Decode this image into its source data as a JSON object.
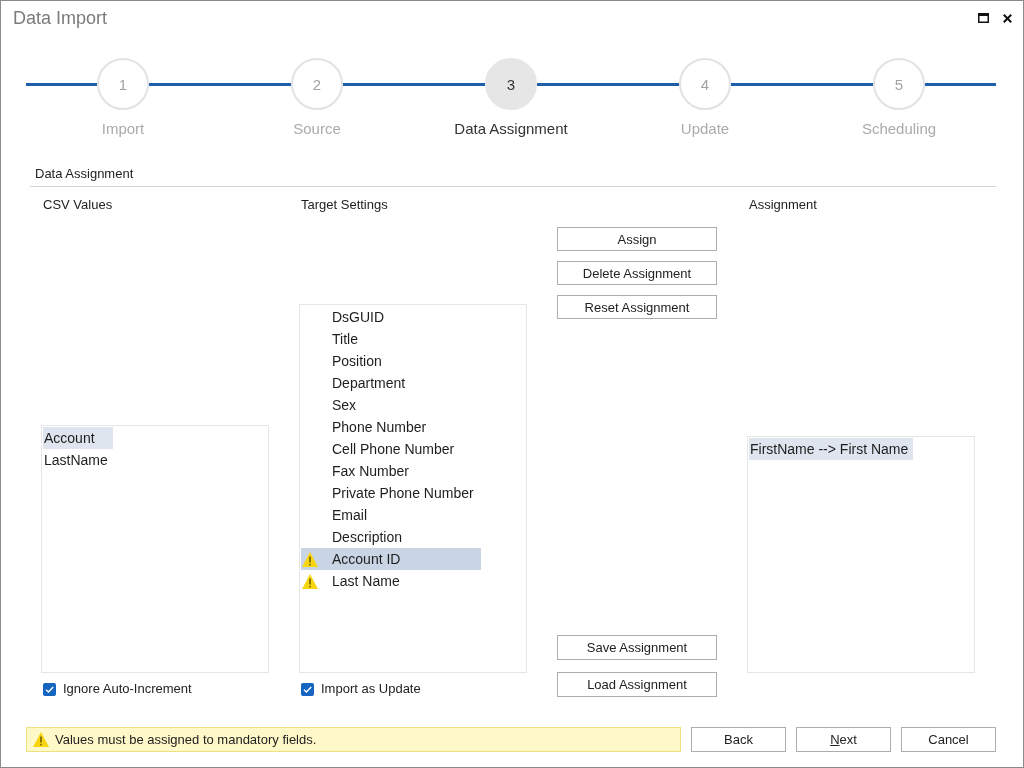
{
  "window": {
    "title": "Data Import"
  },
  "steps": [
    {
      "number": "1",
      "label": "Import",
      "selected": false
    },
    {
      "number": "2",
      "label": "Source",
      "selected": false
    },
    {
      "number": "3",
      "label": "Data Assignment",
      "selected": true
    },
    {
      "number": "4",
      "label": "Update",
      "selected": false
    },
    {
      "number": "5",
      "label": "Scheduling",
      "selected": false
    }
  ],
  "section": {
    "title": "Data Assignment"
  },
  "csv_values": {
    "heading": "CSV Values",
    "focused": false,
    "items": [
      {
        "label": "Account",
        "selected": true
      },
      {
        "label": "LastName",
        "selected": false
      }
    ]
  },
  "target_settings": {
    "heading": "Target Settings",
    "focused": true,
    "items": [
      {
        "label": "DsGUID",
        "warning": false,
        "selected": false
      },
      {
        "label": "Title",
        "warning": false,
        "selected": false
      },
      {
        "label": "Position",
        "warning": false,
        "selected": false
      },
      {
        "label": "Department",
        "warning": false,
        "selected": false
      },
      {
        "label": "Sex",
        "warning": false,
        "selected": false
      },
      {
        "label": "Phone Number",
        "warning": false,
        "selected": false
      },
      {
        "label": "Cell Phone Number",
        "warning": false,
        "selected": false
      },
      {
        "label": "Fax Number",
        "warning": false,
        "selected": false
      },
      {
        "label": "Private Phone Number",
        "warning": false,
        "selected": false
      },
      {
        "label": "Email",
        "warning": false,
        "selected": false
      },
      {
        "label": "Description",
        "warning": false,
        "selected": false
      },
      {
        "label": "Account ID",
        "warning": true,
        "selected": true
      },
      {
        "label": "Last Name",
        "warning": true,
        "selected": false
      }
    ]
  },
  "action_buttons": [
    "Assign",
    "Delete Assignment",
    "Reset Assignment"
  ],
  "file_buttons": [
    "Save Assignment",
    "Load Assignment"
  ],
  "assignment": {
    "heading": "Assignment",
    "focused": false,
    "items": [
      {
        "label": "FirstName --> First Name",
        "selected": true
      }
    ]
  },
  "options": [
    {
      "label": "Ignore Auto-Increment",
      "checked": true
    },
    {
      "label": "Import as Update",
      "checked": true
    }
  ],
  "status": {
    "kind": "warning",
    "message": "Values must be assigned to mandatory fields."
  },
  "nav_buttons": [
    {
      "label": "Back",
      "mnemonic": false
    },
    {
      "label": "Next",
      "mnemonic": true
    },
    {
      "label": "Cancel",
      "mnemonic": false
    }
  ]
}
